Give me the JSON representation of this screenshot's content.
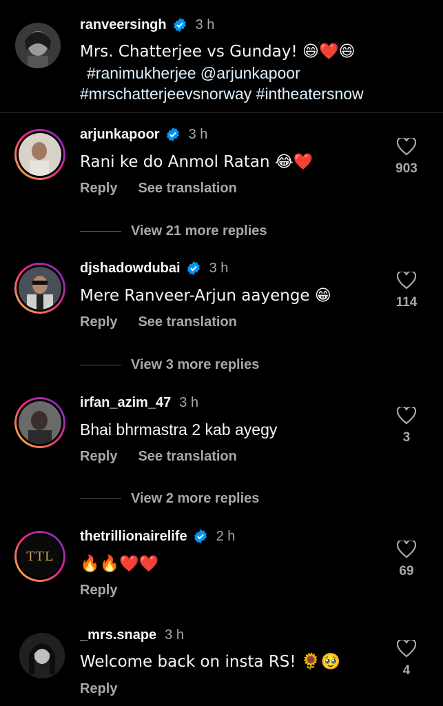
{
  "caption": {
    "username": "ranveersingh",
    "time": "3 h",
    "line1": "Mrs. Chatterjee vs Gunday! 😄❤️😄",
    "line2": "#ranimukherjee @arjunkapoor",
    "line3": "#mrschatterjeevsnorway #intheatersnow"
  },
  "comments": [
    {
      "username": "arjunkapoor",
      "verified": true,
      "time": "3 h",
      "text": "Rani ke do Anmol Ratan 😂❤️",
      "reply_label": "Reply",
      "translate_label": "See translation",
      "likes": "903",
      "view_more": "View 21 more replies"
    },
    {
      "username": "djshadowdubai",
      "verified": true,
      "time": "3 h",
      "text": "Mere Ranveer-Arjun aayenge 😁",
      "reply_label": "Reply",
      "translate_label": "See translation",
      "likes": "114",
      "view_more": "View 3 more replies"
    },
    {
      "username": "irfan_azim_47",
      "verified": false,
      "time": "3 h",
      "text": "Bhai bhrmastra 2 kab ayegy",
      "reply_label": "Reply",
      "translate_label": "See translation",
      "likes": "3",
      "view_more": "View 2 more replies"
    },
    {
      "username": "thetrillionairelife",
      "verified": true,
      "time": "2 h",
      "text": "🔥🔥❤️❤️",
      "reply_label": "Reply",
      "likes": "69",
      "avatar_text": "TTL"
    },
    {
      "username": "_mrs.snape",
      "verified": false,
      "time": "3 h",
      "text": "Welcome back on insta RS! 🌻🥹",
      "reply_label": "Reply",
      "likes": "4"
    }
  ],
  "colors": {
    "background": "#000000",
    "verified": "#0095f6",
    "secondary_text": "#a8a8a8"
  }
}
